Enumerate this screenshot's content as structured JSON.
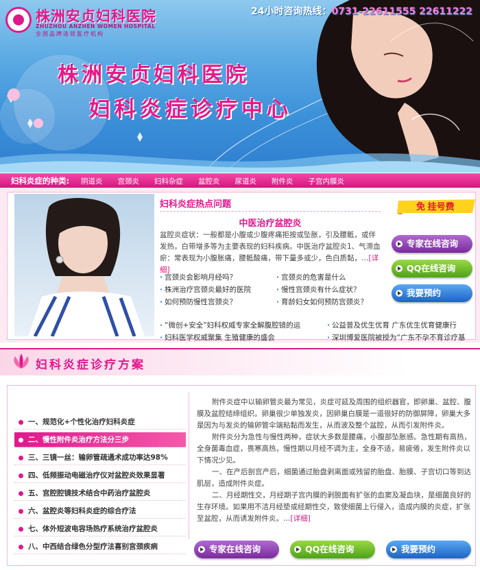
{
  "header": {
    "logo_cn": "株洲安贞妇科医院",
    "logo_en": "ZHUZHOU ANZHEN WOMEN HOSPITAL",
    "logo_tag": "全国品牌连锁医疗机构",
    "hotline_label": "24小时咨询热线：",
    "hotline_numbers": "0731-22611555  22611222",
    "banner_title1": "株洲安贞妇科医院",
    "banner_title2": "妇科炎症诊疗中心"
  },
  "nav": {
    "lead": "妇科炎症的种类:",
    "items": [
      "阴道炎",
      "宫颈炎",
      "妇科杂症",
      "盆腔炎",
      "尿道炎",
      "附件炎",
      "子宫内膜炎"
    ]
  },
  "hot": {
    "heading": "妇科炎症热点问题",
    "subheading": "中医治疗盆腔炎",
    "paragraph": "盆腔炎症状：一般都是小腹或少腹疼痛拒按或坠胀，引及腰骶，或伴发热，白带增多等为主要表现的妇科疾病。中医治疗盆腔炎1、气滞血瘀：常表现为小腹胀痛，腰骶酸痛，带下量多或少，色白质黏，…",
    "more": "[详细]",
    "questions_left": [
      "宫颈炎会影响月经吗？",
      "株洲治疗宫颈炎最好的医院",
      "如何预防慢性宫颈炎？"
    ],
    "questions_right": [
      "宫颈炎的危害是什么",
      "慢性宫颈炎有什么症状？",
      "育龄妇女如何预防宫颈炎？"
    ],
    "bottom_left": [
      "“微创+安全”妇科权威专家全解腹腔镜的运",
      "妇科医学权威聚集 生殖健康的盛会"
    ],
    "bottom_right": [
      "公益普及优生优育 广东优生优育健康行",
      "深圳博爱医院被授为“广东不孕不育诊疗基"
    ],
    "free_reg": "免 挂号费"
  },
  "buttons": {
    "consult": "专家在线咨询",
    "qq": "QQ在线咨询",
    "book": "我要预约"
  },
  "plan": {
    "title": "妇科炎症诊疗方案",
    "menu": [
      "一、规范化+个性化治疗妇科炎症",
      "二、慢性附件炎治疗方法分三步",
      "三、三镜一丝：输卵管疏通术成功率达98%",
      "四、低频振动电磁治疗仪对盆腔炎效果显著",
      "五、宫腔腔镜技术结合中药治疗盆腔炎",
      "六、盆腔炎等妇科炎症的综合疗法",
      "七、体外短波电容场热疗系统治疗盆腔炎",
      "八、中西结合绿色分型疗法喜别宫颈疾病"
    ],
    "paragraphs": [
      "附件炎症中以输卵管炎最为常见，炎症可延及周围的组织器官，即卵巢、盆腔、腹膜及盆腔结缔组织。卵巢很少单独发炎，因卵巢白膜是一道很好的防御屏障，卵巢大多是因为与发炎的输卵管伞端粘黏而发生，从而波及整个盆腔，从而引发附件炎。",
      "附件炎分为急性与慢性两种，症状大多数是腰痛，小腹部坠胀感。急性期有高热，全身菌毒血症，畏寒高热，慢性期以月经不调为主，全身不适，易疲倦，发生附件炎以下情况少见。",
      "一、在产后剖宫产后，细菌通过胎盘剥离面或残留的胎盘、胎膜、子宫切口等到达肌层，造成附件炎症。",
      "二、月经期性交，月经期子宫内膜的剥脱面有扩张的血窦及凝血块，是细菌良好的生存环境。如果用不洁月经垫或经期性交，致使细菌上行侵入，造成内膜的炎症，扩张至盆腔，从而诱发附件炎。…"
    ],
    "more": "[详细]"
  },
  "colors": {
    "brand_pink": "#e0188c",
    "sky_blue": "#3a8fd8",
    "btn_purple": "#7a2a9e",
    "btn_green": "#4ea31a",
    "btn_blue": "#1e63c8"
  }
}
